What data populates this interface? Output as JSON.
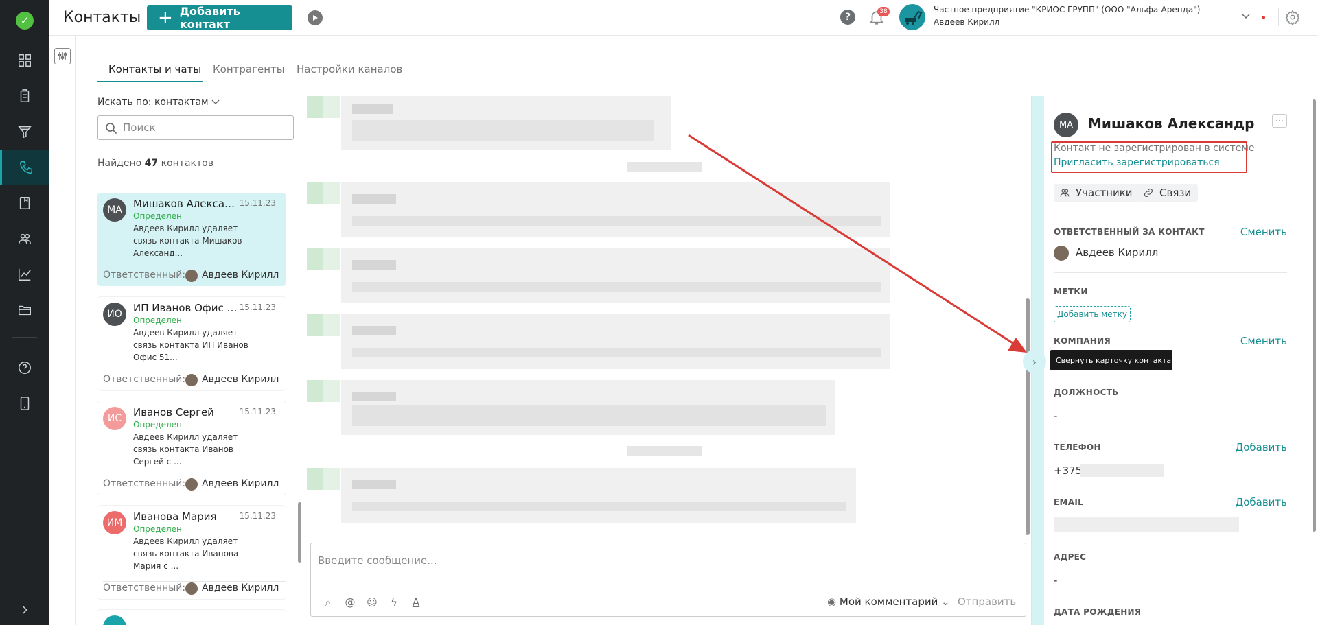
{
  "header": {
    "title": "Контакты",
    "add_button": "Добавить контакт",
    "notifications_count": "38",
    "org_name": "Частное предприятие \"КРИОС ГРУПП\" (ООО \"Альфа-Аренда\")",
    "user_name": "Авдеев Кирилл"
  },
  "tabs": [
    "Контакты и чаты",
    "Контрагенты",
    "Настройки каналов"
  ],
  "list": {
    "search_by": "Искать по: контактам",
    "search_placeholder": "Поиск",
    "found_prefix": "Найдено",
    "found_count": "47",
    "found_suffix": "контактов",
    "responsible_label": "Ответственный:",
    "cards": [
      {
        "initials": "МА",
        "name": "Мишаков Александр",
        "date": "15.11.23",
        "status": "Определен",
        "desc": "Авдеев Кирилл удаляет связь контакта Мишаков Александ...",
        "responsible": "Авдеев Кирилл",
        "color": "#4d5154"
      },
      {
        "initials": "ИО",
        "name": "ИП Иванов Офис 51...",
        "date": "15.11.23",
        "status": "Определен",
        "desc": "Авдеев Кирилл удаляет связь контакта ИП Иванов Офис 51...",
        "responsible": "Авдеев Кирилл",
        "color": "#4d5154"
      },
      {
        "initials": "ИС",
        "name": "Иванов Сергей",
        "date": "15.11.23",
        "status": "Определен",
        "desc": "Авдеев Кирилл удаляет связь контакта Иванов Сергей с ...",
        "responsible": "Авдеев Кирилл",
        "color": "#f39a9a"
      },
      {
        "initials": "ИМ",
        "name": "Иванова Мария",
        "date": "15.11.23",
        "status": "Определен",
        "desc": "Авдеев Кирилл удаляет связь контакта Иванова Мария с ...",
        "responsible": "Авдеев Кирилл",
        "color": "#ec6b6b"
      }
    ]
  },
  "composer": {
    "placeholder": "Введите сообщение...",
    "comment_label": "Мой комментарий",
    "send_label": "Отправить"
  },
  "toggle": {
    "tooltip": "Свернуть карточку контакта"
  },
  "contact": {
    "initials": "МА",
    "name": "Мишаков Александр",
    "not_registered": "Контакт не зарегистрирован в системе",
    "invite_link": "Пригласить зарегистрироваться",
    "participants": "Участники",
    "links": "Связи",
    "responsible_label": "ОТВЕТСТВЕННЫЙ ЗА КОНТАКТ",
    "change": "Сменить",
    "responsible_name": "Авдеев Кирилл",
    "tags_label": "МЕТКИ",
    "add_tag": "Добавить метку",
    "company_label": "КОМПАНИЯ",
    "position_label": "ДОЛЖНОСТЬ",
    "position_value": "-",
    "phone_label": "ТЕЛЕФОН",
    "add": "Добавить",
    "phone_value": "+375",
    "email_label": "EMAIL",
    "address_label": "АДРЕС",
    "address_value": "-",
    "birthday_label": "ДАТА РОЖДЕНИЯ"
  },
  "colors": {
    "accent": "#168f93",
    "rail": "#1f2326",
    "active_card": "#d5f3f4",
    "status_green": "#2fae4a",
    "annotation_red": "#d93b36"
  }
}
